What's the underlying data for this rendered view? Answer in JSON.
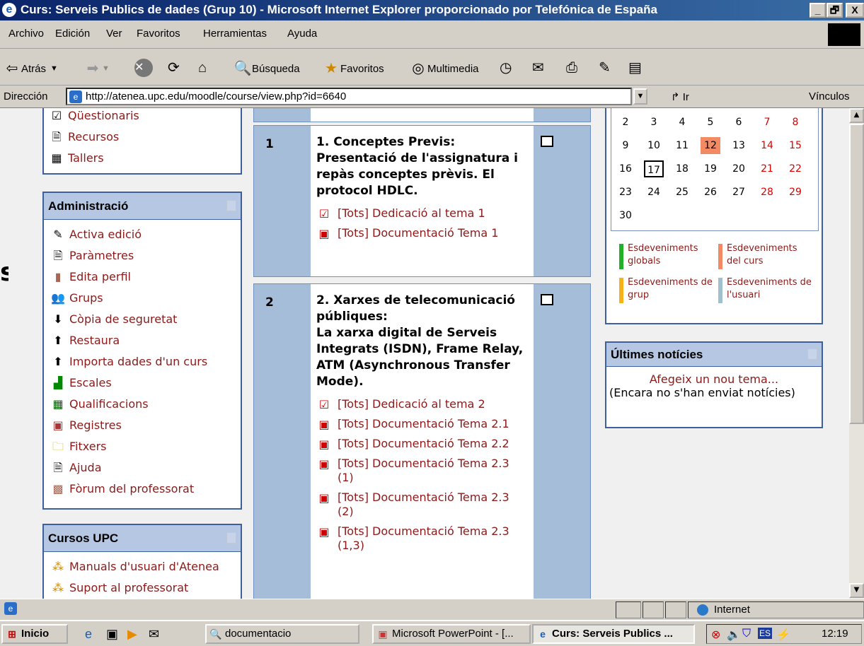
{
  "window": {
    "title": "Curs: Serveis Publics de dades (Grup 10) - Microsoft Internet Explorer proporcionado por Telefónica de España",
    "minimize": "_",
    "maximize": "🗗",
    "close": "X"
  },
  "menu": [
    "Archivo",
    "Edición",
    "Ver",
    "Favoritos",
    "Herramientas",
    "Ayuda"
  ],
  "toolbar": {
    "back": "Atrás",
    "search": "Búsqueda",
    "favorites": "Favoritos",
    "multimedia": "Multimedia"
  },
  "address": {
    "label": "Dirección",
    "url": "http://atenea.upc.edu/moodle/course/view.php?id=6640",
    "go": "Ir",
    "links": "Vínculos"
  },
  "left_blocks": {
    "top_items": [
      {
        "icon": "checkbox-icon",
        "label": "Qüestionaris"
      },
      {
        "icon": "document-icon",
        "label": "Recursos"
      },
      {
        "icon": "workshop-icon",
        "label": "Tallers"
      }
    ],
    "admin": {
      "title": "Administració",
      "items": [
        {
          "icon": "pencil-icon",
          "label": "Activa edició"
        },
        {
          "icon": "document-icon",
          "label": "Paràmetres"
        },
        {
          "icon": "door-icon",
          "label": "Edita perfil"
        },
        {
          "icon": "users-icon",
          "label": "Grups"
        },
        {
          "icon": "backup-icon",
          "label": "Còpia de seguretat"
        },
        {
          "icon": "restore-icon",
          "label": "Restaura"
        },
        {
          "icon": "import-icon",
          "label": "Importa dades d'un curs"
        },
        {
          "icon": "scales-icon",
          "label": "Escales"
        },
        {
          "icon": "grades-icon",
          "label": "Qualificacions"
        },
        {
          "icon": "logs-icon",
          "label": "Registres"
        },
        {
          "icon": "folder-icon",
          "label": "Fitxers"
        },
        {
          "icon": "help-icon",
          "label": "Ajuda"
        },
        {
          "icon": "forum-icon",
          "label": "Fòrum del professorat"
        }
      ]
    },
    "courses": {
      "title": "Cursos UPC",
      "items": [
        {
          "icon": "link-icon",
          "label": "Manuals d'usuari d'Atenea"
        },
        {
          "icon": "link-icon",
          "label": "Suport al professorat"
        }
      ]
    }
  },
  "sections": [
    {
      "num": "1",
      "title": "1. Conceptes Previs: Presentació de l'assignatura i repàs conceptes prèvis. El protocol HDLC.",
      "resources": [
        {
          "icon": "quiz-icon",
          "label": "[Tots] Dedicació al tema 1"
        },
        {
          "icon": "pdf-icon",
          "label": "[Tots] Documentació Tema 1"
        }
      ]
    },
    {
      "num": "2",
      "title": "2. Xarxes de telecomunicació públiques:",
      "subtitle": "La xarxa digital de Serveis Integrats (ISDN), Frame Relay, ATM (Asynchronous Transfer Mode).",
      "resources": [
        {
          "icon": "quiz-icon",
          "label": "[Tots] Dedicació al tema 2"
        },
        {
          "icon": "pdf-icon",
          "label": "[Tots] Documentació Tema 2.1"
        },
        {
          "icon": "pdf-icon",
          "label": "[Tots] Documentació Tema 2.2"
        },
        {
          "icon": "pdf-icon",
          "label": "[Tots] Documentació Tema 2.3 (1)"
        },
        {
          "icon": "pdf-icon",
          "label": "[Tots] Documentació Tema 2.3 (2)"
        },
        {
          "icon": "pdf-icon",
          "label": "[Tots] Documentació Tema 2.3 (1,3)"
        }
      ]
    }
  ],
  "calendar": {
    "rows": [
      [
        "2",
        "3",
        "4",
        "5",
        "6",
        "7",
        "8"
      ],
      [
        "9",
        "10",
        "11",
        "12",
        "13",
        "14",
        "15"
      ],
      [
        "16",
        "17",
        "18",
        "19",
        "20",
        "21",
        "22"
      ],
      [
        "23",
        "24",
        "25",
        "26",
        "27",
        "28",
        "29"
      ],
      [
        "30",
        "",
        "",
        "",
        "",
        "",
        ""
      ]
    ],
    "today": "17",
    "event_day": "12",
    "legend": [
      {
        "label": "Esdeveniments globals",
        "color": "#22b22a"
      },
      {
        "label": "Esdeveniments del curs",
        "color": "#f28a63"
      },
      {
        "label": "Esdeveniments de grup",
        "color": "#f5b21b"
      },
      {
        "label": "Esdeveniments de l'usuari",
        "color": "#a0c0cc"
      }
    ]
  },
  "news": {
    "title": "Últimes notícies",
    "add": "Afegeix un nou tema...",
    "empty": "(Encara no s'han enviat notícies)"
  },
  "status": {
    "zone": "Internet"
  },
  "taskbar": {
    "start": "Inicio",
    "tasks": [
      "documentacio",
      "Microsoft PowerPoint - [...",
      "Curs: Serveis Publics ..."
    ],
    "lang": "ES",
    "clock": "12:19"
  }
}
